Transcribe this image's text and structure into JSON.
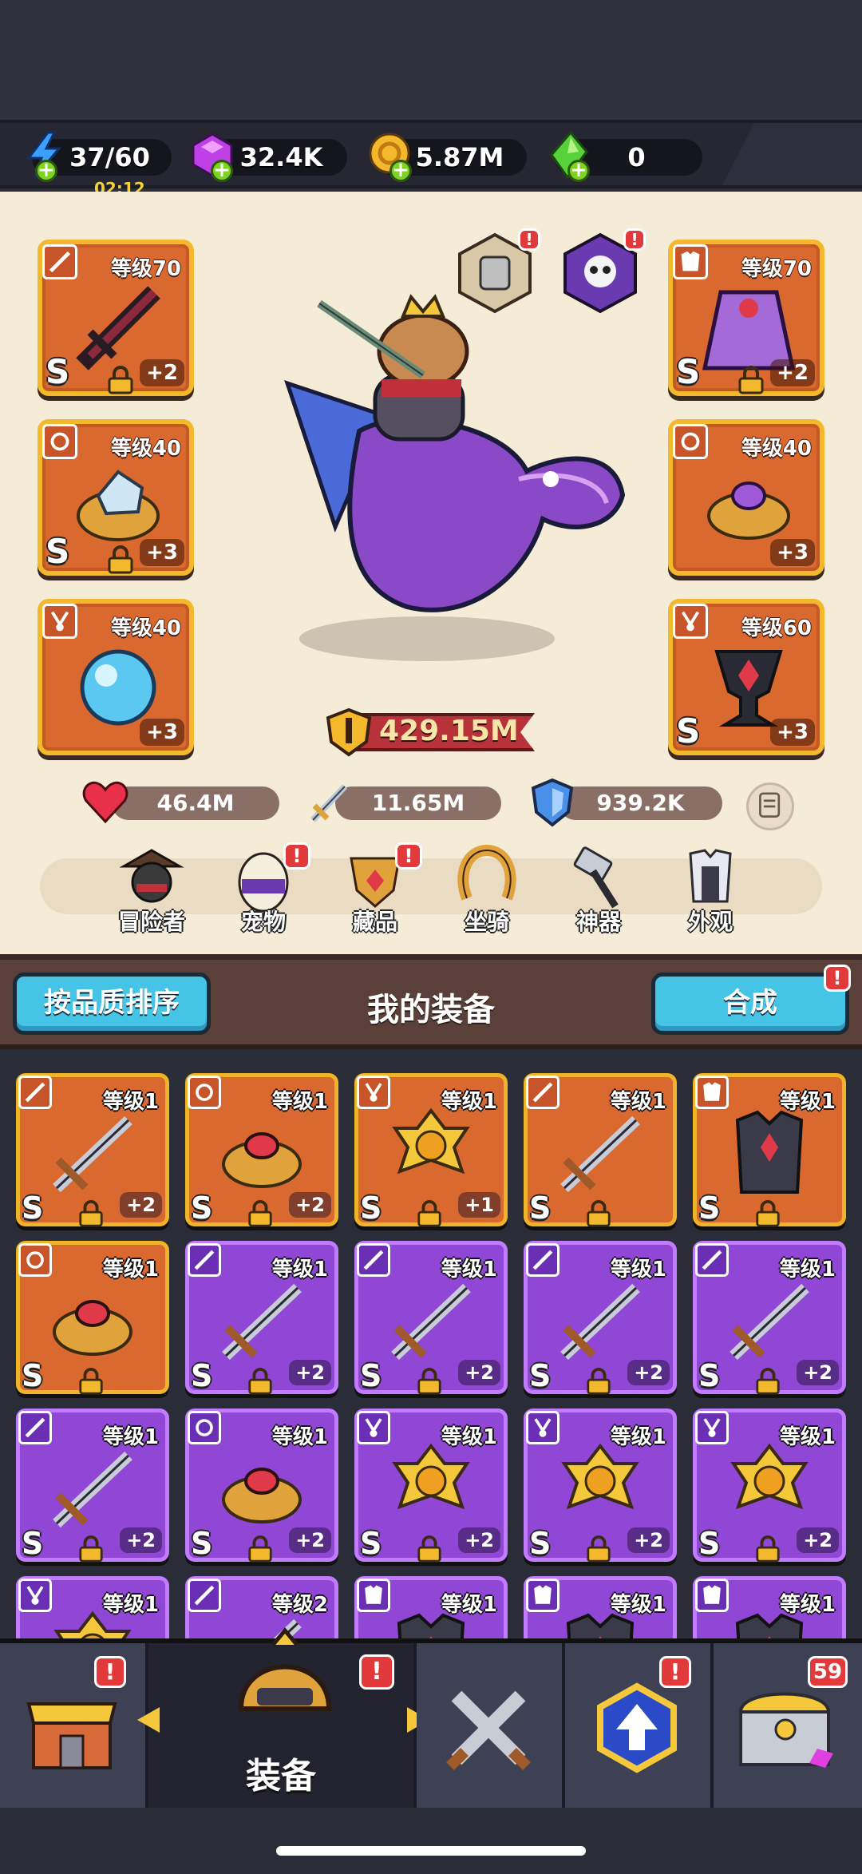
{
  "resources": {
    "energy": {
      "value": "37/60",
      "timer": "02:12",
      "icon": "lightning-icon"
    },
    "gems": {
      "value": "32.4K",
      "icon": "purple-gem-icon"
    },
    "coins": {
      "value": "5.87M",
      "icon": "gold-coin-icon"
    },
    "crystals": {
      "value": "0",
      "icon": "green-crystal-icon"
    }
  },
  "equipped": {
    "left": [
      {
        "level": "等级70",
        "grade": "S",
        "plus": "+2",
        "locked": true,
        "type": "weapon",
        "item": "dark-sword"
      },
      {
        "level": "等级40",
        "grade": "S",
        "plus": "+3",
        "locked": true,
        "type": "ring",
        "item": "crystal-ring"
      },
      {
        "level": "等级40",
        "grade": "",
        "plus": "+3",
        "locked": false,
        "type": "necklace",
        "item": "blue-orb"
      }
    ],
    "right": [
      {
        "level": "等级70",
        "grade": "S",
        "plus": "+2",
        "locked": true,
        "type": "armor",
        "item": "purple-cloak"
      },
      {
        "level": "等级40",
        "grade": "",
        "plus": "+3",
        "locked": false,
        "type": "ring",
        "item": "amethyst-ring"
      },
      {
        "level": "等级60",
        "grade": "S",
        "plus": "+3",
        "locked": false,
        "type": "necklace",
        "item": "ruby-chalice"
      }
    ]
  },
  "power": "429.15M",
  "stats": {
    "hp": "46.4M",
    "attack": "11.65M",
    "defense": "939.2K"
  },
  "nav": [
    {
      "label": "冒险者",
      "badge": false
    },
    {
      "label": "宠物",
      "badge": true
    },
    {
      "label": "藏品",
      "badge": true
    },
    {
      "label": "坐骑",
      "badge": false
    },
    {
      "label": "神器",
      "badge": false
    },
    {
      "label": "外观",
      "badge": false
    }
  ],
  "inventory": {
    "sort_label": "按品质排序",
    "title": "我的装备",
    "merge_label": "合成",
    "items": [
      {
        "level": "等级1",
        "rarity": "orange",
        "grade": "S",
        "plus": "+2",
        "type": "weapon"
      },
      {
        "level": "等级1",
        "rarity": "orange",
        "grade": "S",
        "plus": "+2",
        "type": "ring"
      },
      {
        "level": "等级1",
        "rarity": "orange",
        "grade": "S",
        "plus": "+1",
        "type": "necklace"
      },
      {
        "level": "等级1",
        "rarity": "orange",
        "grade": "S",
        "plus": "",
        "type": "weapon"
      },
      {
        "level": "等级1",
        "rarity": "orange",
        "grade": "S",
        "plus": "",
        "type": "armor"
      },
      {
        "level": "等级1",
        "rarity": "orange",
        "grade": "S",
        "plus": "",
        "type": "ring"
      },
      {
        "level": "等级1",
        "rarity": "purple",
        "grade": "S",
        "plus": "+2",
        "type": "weapon"
      },
      {
        "level": "等级1",
        "rarity": "purple",
        "grade": "S",
        "plus": "+2",
        "type": "weapon"
      },
      {
        "level": "等级1",
        "rarity": "purple",
        "grade": "S",
        "plus": "+2",
        "type": "weapon"
      },
      {
        "level": "等级1",
        "rarity": "purple",
        "grade": "S",
        "plus": "+2",
        "type": "weapon"
      },
      {
        "level": "等级1",
        "rarity": "purple",
        "grade": "S",
        "plus": "+2",
        "type": "weapon"
      },
      {
        "level": "等级1",
        "rarity": "purple",
        "grade": "S",
        "plus": "+2",
        "type": "ring"
      },
      {
        "level": "等级1",
        "rarity": "purple",
        "grade": "S",
        "plus": "+2",
        "type": "necklace"
      },
      {
        "level": "等级1",
        "rarity": "purple",
        "grade": "S",
        "plus": "+2",
        "type": "necklace"
      },
      {
        "level": "等级1",
        "rarity": "purple",
        "grade": "S",
        "plus": "+2",
        "type": "necklace"
      },
      {
        "level": "等级1",
        "rarity": "purple",
        "grade": "",
        "plus": "",
        "type": "necklace"
      },
      {
        "level": "等级2",
        "rarity": "purple",
        "grade": "",
        "plus": "",
        "type": "weapon"
      },
      {
        "level": "等级1",
        "rarity": "purple",
        "grade": "",
        "plus": "",
        "type": "armor"
      },
      {
        "level": "等级1",
        "rarity": "purple",
        "grade": "",
        "plus": "",
        "type": "armor"
      },
      {
        "level": "等级1",
        "rarity": "purple",
        "grade": "",
        "plus": "",
        "type": "armor"
      }
    ]
  },
  "tabs": [
    {
      "name": "shop",
      "label": "",
      "badge": "!"
    },
    {
      "name": "equipment",
      "label": "装备",
      "badge": "!"
    },
    {
      "name": "battle",
      "label": "",
      "badge": ""
    },
    {
      "name": "upgrade",
      "label": "",
      "badge": "!"
    },
    {
      "name": "chest",
      "label": "",
      "badge": "59"
    }
  ],
  "colors": {
    "orange_rarity": "#d9692e",
    "purple_rarity": "#9047d6",
    "gold_border": "#f0b428",
    "button_blue": "#46c4e6",
    "badge_red": "#e23a3a"
  }
}
